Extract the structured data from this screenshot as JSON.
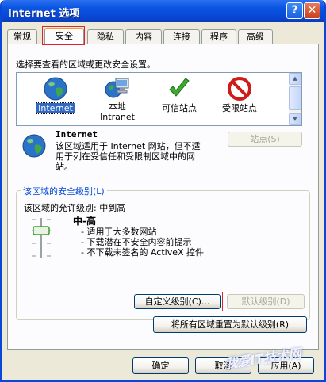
{
  "window": {
    "title": "Internet 选项",
    "help_label": "?",
    "close_label": "✕"
  },
  "tabs": [
    {
      "label": "常规"
    },
    {
      "label": "安全"
    },
    {
      "label": "隐私"
    },
    {
      "label": "内容"
    },
    {
      "label": "连接"
    },
    {
      "label": "程序"
    },
    {
      "label": "高级"
    }
  ],
  "active_tab": "安全",
  "security": {
    "prompt": "选择要查看的区域或更改安全设置。",
    "zones": [
      {
        "label": "Internet",
        "icon": "globe-icon",
        "selected": true
      },
      {
        "label": "本地\nIntranet",
        "icon": "intranet-icon",
        "selected": false
      },
      {
        "label": "可信站点",
        "icon": "checkmark-icon",
        "selected": false
      },
      {
        "label": "受限站点",
        "icon": "restricted-icon",
        "selected": false
      }
    ],
    "zone_info": {
      "name": "Internet",
      "description": "该区域适用于 Internet 网站，但不适用于列在受信任和受限制区域中的网站。",
      "sites_button": "站点(S)"
    },
    "level_group": {
      "title": "该区域的安全级别(L)",
      "allowed": "该区域的允许级别: 中到高",
      "level_name": "中-高",
      "bullets": [
        "- 适用于大多数网站",
        "- 下载潜在不安全内容前提示",
        "- 不下载未签名的 ActiveX 控件"
      ],
      "custom_button": "自定义级别(C)...",
      "default_button": "默认级别(D)"
    },
    "reset_all_button": "将所有区域重置为默认级别(R)"
  },
  "dialog_buttons": {
    "ok": "确定",
    "cancel": "取消",
    "apply": "应用(A)"
  },
  "watermark": "我爱IT技术网",
  "colors": {
    "titlebar": "#0a55e2",
    "highlight_box": "#e0242a",
    "selection": "#316ac5",
    "group_title": "#0046d5"
  }
}
